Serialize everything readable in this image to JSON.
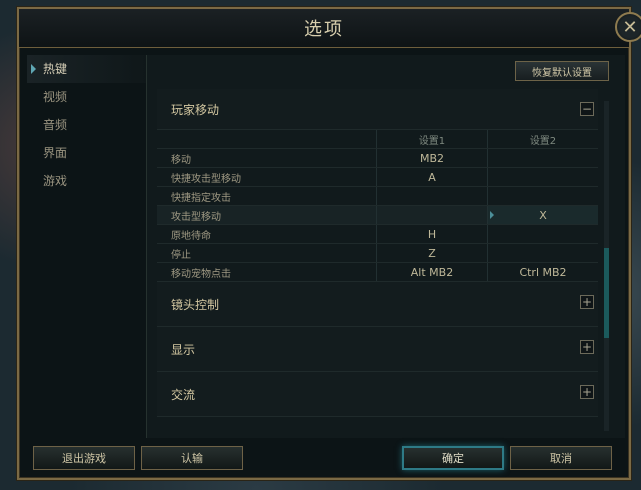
{
  "window": {
    "title": "选项",
    "close_glyph": "✕"
  },
  "sidebar": {
    "items": [
      {
        "label": "热键",
        "active": true
      },
      {
        "label": "视频"
      },
      {
        "label": "音频"
      },
      {
        "label": "界面"
      },
      {
        "label": "游戏"
      }
    ]
  },
  "content": {
    "reset_label": "恢复默认设置",
    "sections": {
      "player_move": {
        "label": "玩家移动",
        "toggle": "−"
      },
      "camera": {
        "label": "镜头控制",
        "toggle": "+"
      },
      "display": {
        "label": "显示",
        "toggle": "+"
      },
      "chat": {
        "label": "交流",
        "toggle": "+"
      }
    },
    "columns": {
      "set1": "设置1",
      "set2": "设置2"
    },
    "rows": [
      {
        "name": "移动",
        "set1": "MB2",
        "set2": ""
      },
      {
        "name": "快捷攻击型移动",
        "set1": "A",
        "set2": ""
      },
      {
        "name": "快捷指定攻击",
        "set1": "",
        "set2": ""
      },
      {
        "name": "攻击型移动",
        "set1": "",
        "set2": "X"
      },
      {
        "name": "原地待命",
        "set1": "H",
        "set2": ""
      },
      {
        "name": "停止",
        "set1": "Z",
        "set2": ""
      },
      {
        "name": "移动宠物点击",
        "set1": "Alt  MB2",
        "set2": "Ctrl  MB2"
      }
    ]
  },
  "footer": {
    "exit_label": "退出游戏",
    "surrender_label": "认输",
    "ok_label": "确定",
    "cancel_label": "取消"
  },
  "icons": {
    "close": "close-icon",
    "collapse": "minus-icon",
    "expand": "plus-icon"
  },
  "colors": {
    "frame_gold": "#7b6a45",
    "accent_teal": "#2e7a86",
    "text_gold": "#d4c8a2"
  }
}
